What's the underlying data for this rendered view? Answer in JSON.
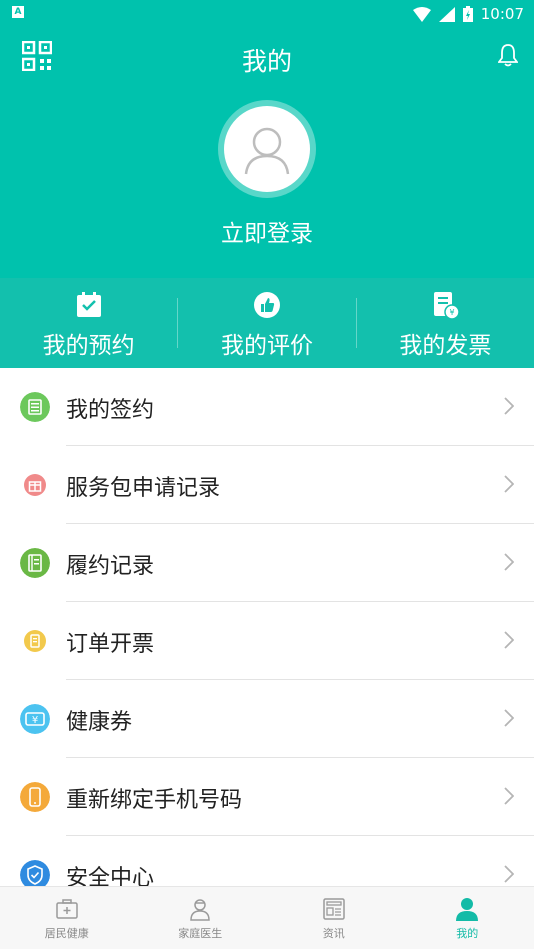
{
  "status_bar": {
    "time": "10:07",
    "notification_icon": "app-notification-icon"
  },
  "header": {
    "title": "我的",
    "login_text": "立即登录"
  },
  "quick_actions": [
    {
      "label": "我的预约",
      "icon": "calendar-check-icon"
    },
    {
      "label": "我的评价",
      "icon": "thumbs-up-icon"
    },
    {
      "label": "我的发票",
      "icon": "invoice-icon"
    }
  ],
  "menu": [
    {
      "label": "我的签约",
      "icon": "contract-list-icon",
      "color": "#6cc85c"
    },
    {
      "label": "服务包申请记录",
      "icon": "gift-icon",
      "color": "#f08a8a"
    },
    {
      "label": "履约记录",
      "icon": "record-book-icon",
      "color": "#6ab845"
    },
    {
      "label": "订单开票",
      "icon": "receipt-icon",
      "color": "#f2c94c"
    },
    {
      "label": "健康券",
      "icon": "coupon-icon",
      "color": "#4cc3f0"
    },
    {
      "label": "重新绑定手机号码",
      "icon": "phone-icon",
      "color": "#f4a93a"
    },
    {
      "label": "安全中心",
      "icon": "shield-icon",
      "color": "#2f8be0"
    }
  ],
  "tabs": [
    {
      "label": "居民健康",
      "icon": "medical-kit-icon",
      "active": false
    },
    {
      "label": "家庭医生",
      "icon": "doctor-icon",
      "active": false
    },
    {
      "label": "资讯",
      "icon": "news-icon",
      "active": false
    },
    {
      "label": "我的",
      "icon": "person-icon",
      "active": true
    }
  ],
  "colors": {
    "primary": "#00c2ad",
    "active_tab": "#13bba7"
  }
}
